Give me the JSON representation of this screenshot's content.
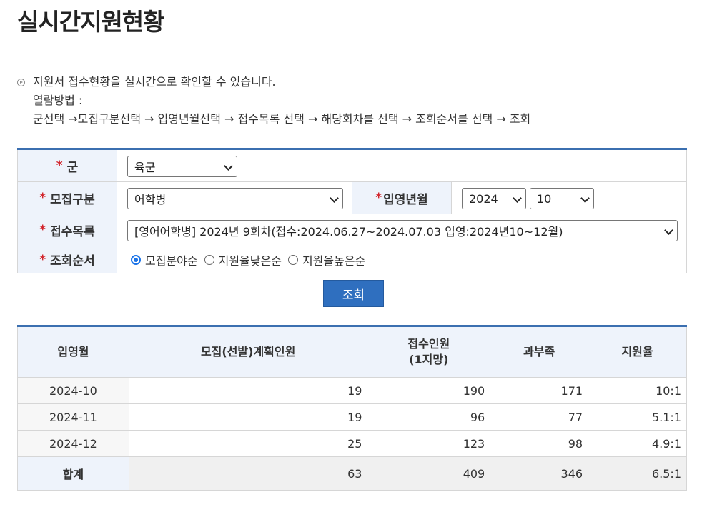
{
  "page": {
    "title": "실시간지원현황"
  },
  "info": {
    "line1": "지원서 접수현황을 실시간으로 확인할 수 있습니다.",
    "line2": "열람방법 :",
    "line3": "군선택 →모집구분선택 → 입영년월선택 → 접수목록 선택 → 해당회차를 선택 → 조회순서를 선택 → 조회"
  },
  "form": {
    "star": "*",
    "military": {
      "label": "군",
      "value": "육군"
    },
    "recruit_type": {
      "label": "모집구분",
      "value": "어학병"
    },
    "enlist_date": {
      "label": "입영년월",
      "year": "2024",
      "month": "10"
    },
    "application": {
      "label": "접수목록",
      "value": "[영어어학병] 2024년 9회차(접수:2024.06.27~2024.07.03 입영:2024년10~12월)"
    },
    "sort_order": {
      "label": "조회순서",
      "options": [
        "모집분야순",
        "지원율낮은순",
        "지원율높은순"
      ],
      "selected": 0
    },
    "search_label": "조회"
  },
  "table": {
    "headers": {
      "month": "입영월",
      "planned": "모집(선발)계획인원",
      "applied_line1": "접수인원",
      "applied_line2": "(1지망)",
      "diff": "과부족",
      "ratio": "지원율"
    },
    "rows": [
      {
        "month": "2024-10",
        "planned": "19",
        "applied": "190",
        "diff": "171",
        "ratio": "10:1"
      },
      {
        "month": "2024-11",
        "planned": "19",
        "applied": "96",
        "diff": "77",
        "ratio": "5.1:1"
      },
      {
        "month": "2024-12",
        "planned": "25",
        "applied": "123",
        "diff": "98",
        "ratio": "4.9:1"
      }
    ],
    "total": {
      "label": "합계",
      "planned": "63",
      "applied": "409",
      "diff": "346",
      "ratio": "6.5:1"
    }
  },
  "colors": {
    "accent": "#2f6fbf",
    "header_bg": "#eef3fb",
    "required_star": "#d2232a"
  }
}
